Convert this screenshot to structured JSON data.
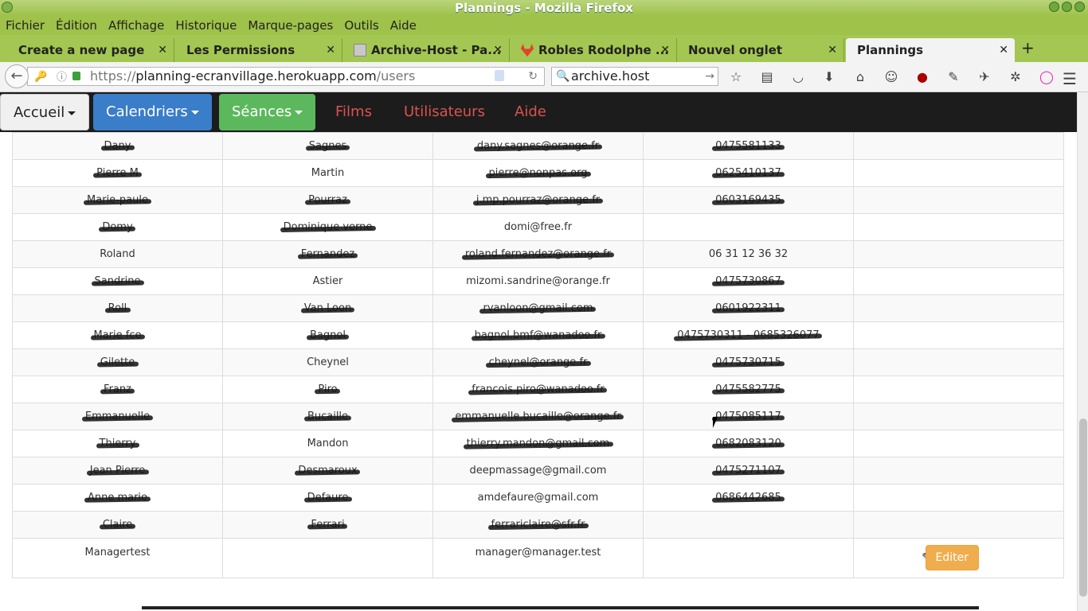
{
  "window": {
    "title": "Plannings - Mozilla Firefox"
  },
  "menu": [
    "Fichier",
    "Édition",
    "Affichage",
    "Historique",
    "Marque-pages",
    "Outils",
    "Aide"
  ],
  "tabs": [
    {
      "label": "Create a new page"
    },
    {
      "label": "Les Permissions"
    },
    {
      "label": "Archive-Host - Pa..."
    },
    {
      "label": "Robles Rodolphe ..."
    },
    {
      "label": "Nouvel onglet"
    },
    {
      "label": "Plannings"
    }
  ],
  "nav": {
    "url_prefix": "https://",
    "url_host": "planning-ecranvillage.herokuapp.com",
    "url_path": "/users",
    "search": "archive.host"
  },
  "appnav": {
    "accueil": "Accueil",
    "calendriers": "Calendriers",
    "seances": "Séances",
    "films": "Films",
    "utilisateurs": "Utilisateurs",
    "aide": "Aide"
  },
  "rows": [
    [
      "Dany",
      "Sagnes",
      "dany.sagnes@orange.fr",
      "0475581133",
      ""
    ],
    [
      "Pierre M",
      "Martin",
      "pierre@nonpas.org",
      "0625410137",
      ""
    ],
    [
      "Marie-paule",
      "Pourraz",
      "j.mp.pourraz@orange.fr",
      "0603169435",
      ""
    ],
    [
      "Domy",
      "Dominique verne",
      "domi@free.fr",
      "",
      ""
    ],
    [
      "Roland",
      "Fernandez",
      "roland.fernandez@orange.fr",
      "06 31 12 36 32",
      ""
    ],
    [
      "Sandrine",
      "Astier",
      "mizomi.sandrine@orange.fr",
      "0475730867",
      ""
    ],
    [
      "Roll",
      "Van Loon",
      "rvanloon@gmail.com",
      "0601922311",
      ""
    ],
    [
      "Marie fce",
      "Bagnol",
      "bagnol.bmf@wanadoo.fr",
      "0475730311 - 0685326077",
      ""
    ],
    [
      "Gilette",
      "Cheynel",
      "cheynel@orange.fr",
      "0475730715",
      ""
    ],
    [
      "Franz",
      "Piro",
      "francois.piro@wanadoo.fr",
      "0475582775",
      ""
    ],
    [
      "Emmanuelle",
      "Bucaille",
      "emmanuelle.bucaille@orange.fr",
      "0475085117",
      ""
    ],
    [
      "Thierry",
      "Mandon",
      "thierry.mandon@gmail.com",
      "0682083120",
      ""
    ],
    [
      "Jean Pierre",
      "Desmaroux",
      "deepmassage@gmail.com",
      "0475271107",
      ""
    ],
    [
      "Anne marie",
      "Defaure",
      "amdefaure@gmail.com",
      "0686442685",
      ""
    ],
    [
      "Claire",
      "Ferrari",
      "ferrariclaire@sfr.fr",
      "",
      ""
    ]
  ],
  "redacted_cols": [
    [
      0,
      1,
      2,
      3
    ],
    [
      0,
      2,
      3
    ],
    [
      0,
      1,
      2,
      3
    ],
    [
      0,
      1
    ],
    [
      1,
      2
    ],
    [
      0,
      3
    ],
    [
      0,
      1,
      2,
      3
    ],
    [
      0,
      1,
      2,
      3
    ],
    [
      0,
      2,
      3
    ],
    [
      0,
      1,
      2,
      3
    ],
    [
      0,
      1,
      2,
      3
    ],
    [
      0,
      2,
      3
    ],
    [
      0,
      1,
      3
    ],
    [
      0,
      1,
      3
    ],
    [
      0,
      1,
      2
    ]
  ],
  "last_row": {
    "first": "Managertest",
    "last": "",
    "email": "manager@manager.test",
    "phone": "",
    "edit_label": "Editer"
  }
}
